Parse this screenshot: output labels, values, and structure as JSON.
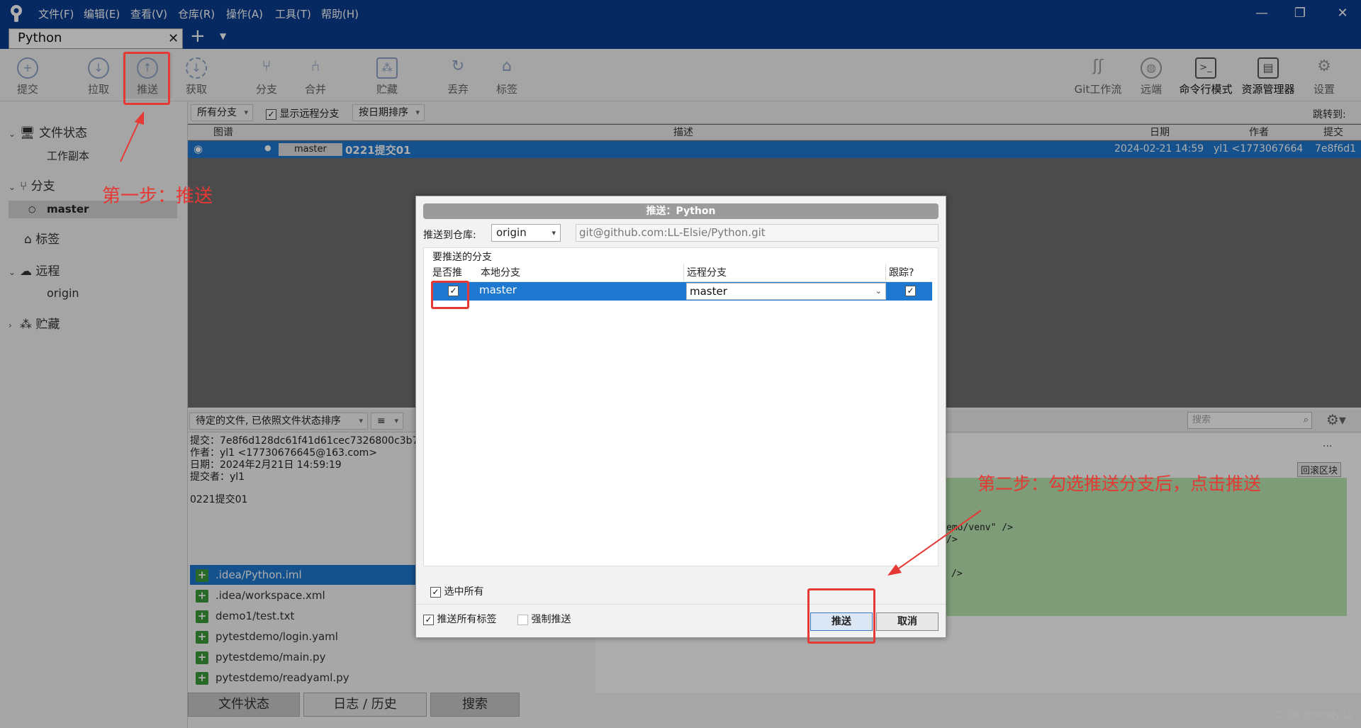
{
  "app": {
    "brand_color": "#0b3d91",
    "accent": "#1e78d0"
  },
  "menu": [
    "文件(F)",
    "编辑(E)",
    "查看(V)",
    "仓库(R)",
    "操作(A)",
    "工具(T)",
    "帮助(H)"
  ],
  "tab": {
    "label": "Python"
  },
  "toolbar": {
    "commit": "提交",
    "pull": "拉取",
    "push": "推送",
    "fetch": "获取",
    "branch": "分支",
    "merge": "合并",
    "stash": "贮藏",
    "discard": "丢弃",
    "tag": "标签",
    "gitflow": "Git工作流",
    "remote": "远端",
    "terminal": "命令行模式",
    "explorer": "资源管理器",
    "settings": "设置"
  },
  "filterbar": {
    "all_branches": "所有分支",
    "show_remote": "显示远程分支",
    "sort": "按日期排序",
    "jump": "跳转到:"
  },
  "columns": {
    "graph": "图谱",
    "desc": "描述",
    "date": "日期",
    "author": "作者",
    "commit": "提交"
  },
  "commit_row": {
    "branch": "master",
    "message": "0221提交01",
    "date": "2024-02-21 14:59",
    "author": "yl1 <1773067664",
    "hash": "7e8f6d1"
  },
  "sidebar": {
    "file_status": "文件状态",
    "working_copy": "工作副本",
    "branches": "分支",
    "master": "master",
    "tags": "标签",
    "remotes": "远程",
    "origin": "origin",
    "stashes": "贮藏"
  },
  "pending_bar": {
    "label": "待定的文件, 已依照文件状态排序",
    "search_placeholder": "搜索"
  },
  "commit_info": {
    "line1": "提交：7e8f6d128dc61f41d61cec7326800c3b7",
    "line2": "作者：yl1 <17730676645@163.com>",
    "line3": "日期：2024年2月21日 14:59:19",
    "line4": "提交者：yl1",
    "message": "0221提交01"
  },
  "files": [
    ".idea/Python.iml",
    ".idea/workspace.xml",
    "demo1/test.txt",
    "pytestdemo/login.yaml",
    "pytestdemo/main.py",
    "pytestdemo/readyaml.py"
  ],
  "diff": {
    "rollback": "回滚区块",
    "more": "···",
    "line1": "emo/venv\" />",
    "line2": "/>",
    "line3": "/>"
  },
  "bottom_tabs": [
    "文件状态",
    "日志 / 历史",
    "搜索"
  ],
  "watermark": "CSDN @cendy-LL",
  "dialog": {
    "title": "推送：Python",
    "push_to_label": "推送到仓库:",
    "remote_select": "origin",
    "remote_url": "git@github.com:LL-Elsie/Python.git",
    "branches_label": "要推送的分支",
    "col_push": "是否推",
    "col_local": "本地分支",
    "col_remote": "远程分支",
    "col_track": "跟踪?",
    "row_local": "master",
    "row_remote": "master",
    "select_all": "选中所有",
    "push_tags": "推送所有标签",
    "force_push": "强制推送",
    "ok": "推送",
    "cancel": "取消"
  },
  "annotations": {
    "step1": "第一步：推送",
    "step2": "第二步：勾选推送分支后，点击推送"
  }
}
